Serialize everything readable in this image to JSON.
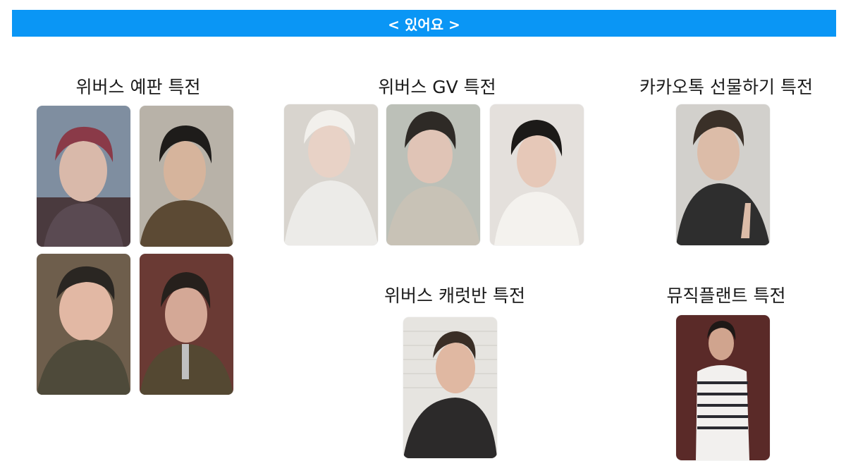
{
  "banner": {
    "label": "< 있어요 >"
  },
  "sections": {
    "weverse_preorder": {
      "title": "위버스 예판 특전"
    },
    "weverse_gv": {
      "title": "위버스 GV 특전"
    },
    "kakaotalk_gift": {
      "title": "카카오톡 선물하기 특전"
    },
    "weverse_carrot": {
      "title": "위버스 캐럿반 특전"
    },
    "musicplant": {
      "title": "뮤직플랜트 특전"
    }
  }
}
